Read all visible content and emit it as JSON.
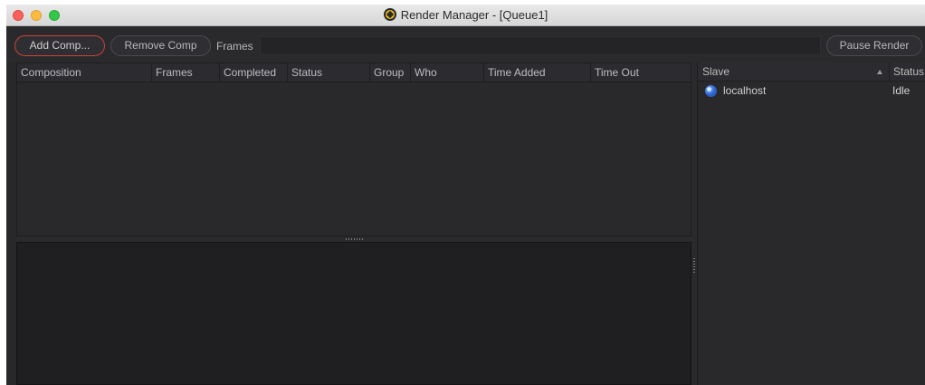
{
  "window": {
    "title": "Render Manager - [Queue1]",
    "app_icon": "fusion-logo-icon"
  },
  "toolbar": {
    "add_comp_label": "Add Comp...",
    "remove_comp_label": "Remove Comp",
    "frames_label": "Frames",
    "frames_value": "",
    "pause_render_label": "Pause Render"
  },
  "queue_table": {
    "columns": [
      "Composition",
      "Frames",
      "Completed",
      "Status",
      "Group",
      "Who",
      "Time Added",
      "Time Out"
    ],
    "rows": []
  },
  "slave_table": {
    "columns": [
      "Slave",
      "Status"
    ],
    "sort_indicator": "ascending",
    "rows": [
      {
        "name": "localhost",
        "status": "Idle",
        "icon": "globe-icon"
      }
    ]
  },
  "colors": {
    "window_bg": "#28282b",
    "accent_border": "#c8413a",
    "slave_icon": "#4f8ef7"
  }
}
